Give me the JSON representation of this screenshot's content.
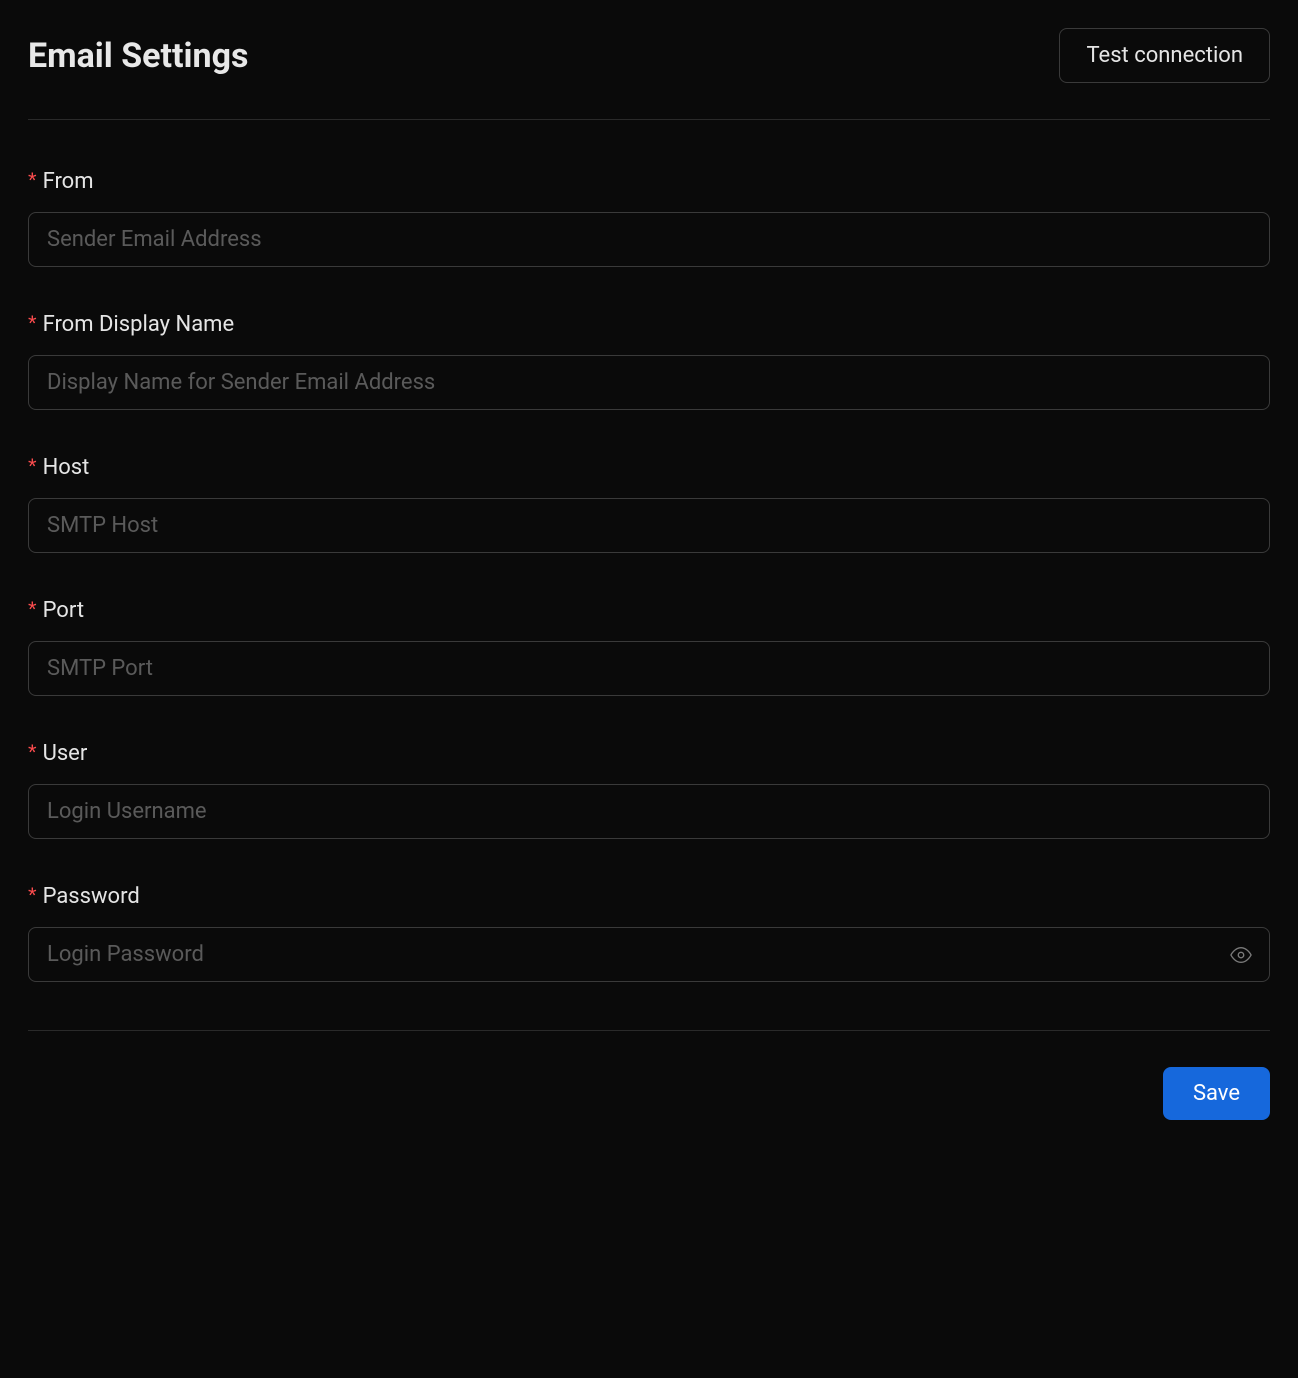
{
  "header": {
    "title": "Email Settings",
    "test_button_label": "Test connection"
  },
  "form": {
    "required_mark": "*",
    "fields": [
      {
        "label": "From",
        "placeholder": "Sender Email Address",
        "value": ""
      },
      {
        "label": "From Display Name",
        "placeholder": "Display Name for Sender Email Address",
        "value": ""
      },
      {
        "label": "Host",
        "placeholder": "SMTP Host",
        "value": ""
      },
      {
        "label": "Port",
        "placeholder": "SMTP Port",
        "value": ""
      },
      {
        "label": "User",
        "placeholder": "Login Username",
        "value": ""
      },
      {
        "label": "Password",
        "placeholder": "Login Password",
        "value": ""
      }
    ]
  },
  "footer": {
    "save_button_label": "Save"
  },
  "icons": {
    "eye": "eye-icon"
  }
}
